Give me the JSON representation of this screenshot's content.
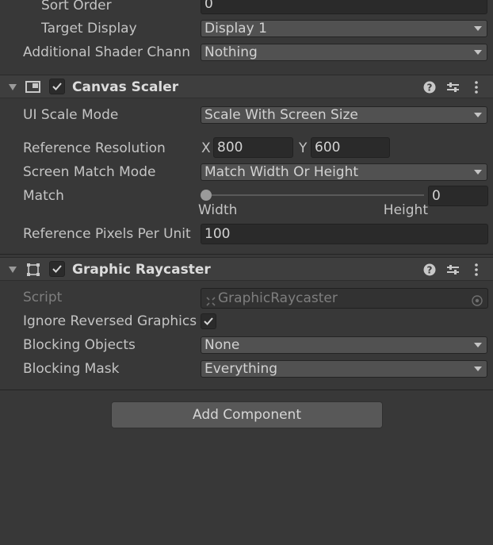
{
  "canvas": {
    "sort_order": {
      "label": "Sort Order",
      "value": "0"
    },
    "target_display": {
      "label": "Target Display",
      "value": "Display 1"
    },
    "additional_shader": {
      "label": "Additional Shader Chann",
      "value": "Nothing"
    }
  },
  "canvas_scaler": {
    "title": "Canvas Scaler",
    "enabled": true,
    "ui_scale_mode": {
      "label": "UI Scale Mode",
      "value": "Scale With Screen Size"
    },
    "reference_resolution": {
      "label": "Reference Resolution",
      "x_label": "X",
      "x": "800",
      "y_label": "Y",
      "y": "600"
    },
    "screen_match_mode": {
      "label": "Screen Match Mode",
      "value": "Match Width Or Height"
    },
    "match": {
      "label": "Match",
      "value": "0",
      "slider_fraction": 0,
      "min_label": "Width",
      "max_label": "Height"
    },
    "reference_pixels": {
      "label": "Reference Pixels Per Unit",
      "value": "100"
    }
  },
  "graphic_raycaster": {
    "title": "Graphic Raycaster",
    "enabled": true,
    "script": {
      "label": "Script",
      "value": "GraphicRaycaster"
    },
    "ignore_reversed": {
      "label": "Ignore Reversed Graphics",
      "checked": true
    },
    "blocking_objects": {
      "label": "Blocking Objects",
      "value": "None"
    },
    "blocking_mask": {
      "label": "Blocking Mask",
      "value": "Everything"
    }
  },
  "add_component": {
    "label": "Add Component"
  },
  "icons": {
    "fold": "foldout-arrow-icon",
    "help": "help-icon",
    "presets": "presets-icon",
    "menu": "kebab-menu-icon",
    "canvas_scaler": "canvas-scaler-icon",
    "raycaster": "rect-transform-icon",
    "script": "script-icon",
    "object_picker": "object-picker-icon"
  }
}
